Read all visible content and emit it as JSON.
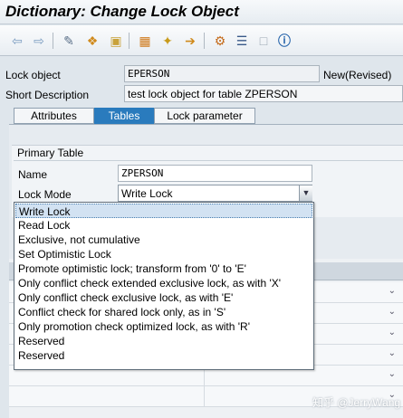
{
  "window": {
    "title": "Dictionary: Change Lock Object"
  },
  "toolbar": {
    "icons": [
      "back-arrow-icon",
      "forward-arrow-icon",
      "glasses-pencil-icon",
      "other-object-icon",
      "activate-icon",
      "where-used-icon",
      "check-icon",
      "magic-wand-icon",
      "transport-icon",
      "hierarchy-icon",
      "list-icon",
      "display-icon",
      "info-icon"
    ]
  },
  "header": {
    "lock_object_label": "Lock object",
    "lock_object_value": "EPERSON",
    "status": "New(Revised)",
    "short_desc_label": "Short Description",
    "short_desc_value": "test lock object for table ZPERSON"
  },
  "tabs": [
    {
      "label": "Attributes"
    },
    {
      "label": "Tables"
    },
    {
      "label": "Lock parameter"
    }
  ],
  "primary_table": {
    "group_title": "Primary Table",
    "name_label": "Name",
    "name_value": "ZPERSON",
    "lock_mode_label": "Lock Mode",
    "lock_mode_value": "Write Lock"
  },
  "dropdown": {
    "options": [
      "Write Lock",
      "Read Lock",
      "Exclusive, not cumulative",
      "Set Optimistic Lock",
      "Promote optimistic lock; transform from '0' to 'E'",
      "Only conflict check extended exclusive lock, as with 'X'",
      "Only conflict check exclusive lock, as with 'E'",
      "Conflict check for shared lock only, as in 'S'",
      "Only promotion check optimized lock, as with 'R'",
      "Reserved",
      "Reserved"
    ],
    "selected_index": 0
  },
  "watermark": "知乎 @JerryWang"
}
